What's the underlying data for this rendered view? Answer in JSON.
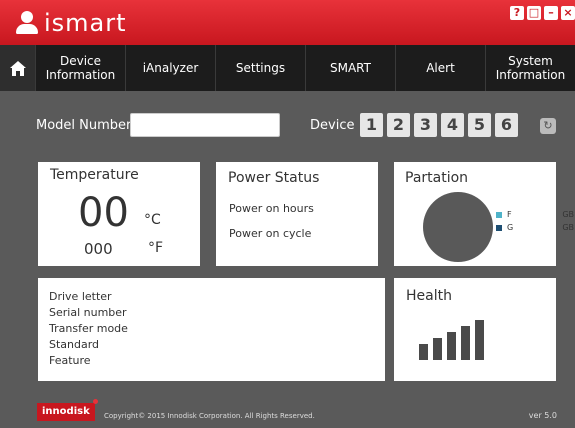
{
  "app": {
    "logo_text": "ismart",
    "brand_color": "#c8171f"
  },
  "window_controls": [
    "?",
    "□",
    "–",
    "×"
  ],
  "nav": {
    "home_icon": "home-icon",
    "items": [
      {
        "label": "Device Information"
      },
      {
        "label": "iAnalyzer"
      },
      {
        "label": "Settings"
      },
      {
        "label": "SMART"
      },
      {
        "label": "Alert"
      },
      {
        "label": "System Information"
      }
    ]
  },
  "model": {
    "label": "Model Number",
    "value": ""
  },
  "device": {
    "label": "Device",
    "buttons": [
      "1",
      "2",
      "3",
      "4",
      "5",
      "6"
    ],
    "refresh_icon": "refresh-icon"
  },
  "temperature": {
    "title": "Temperature",
    "celsius": "00",
    "celsius_unit": "°C",
    "fahrenheit": "000",
    "fahrenheit_unit": "°F"
  },
  "power": {
    "title": "Power Status",
    "hours_label": "Power on hours",
    "cycle_label": "Power on cycle"
  },
  "partition": {
    "title": "Partation",
    "legend": [
      {
        "label": "F",
        "unit": "GB",
        "color": "#4fb3c9"
      },
      {
        "label": "G",
        "unit": "GB",
        "color": "#1f4f73"
      }
    ],
    "pie_color": "#595959"
  },
  "drive_info": {
    "lines": [
      "Drive letter",
      "Serial number",
      "Transfer mode",
      "Standard",
      "Feature"
    ]
  },
  "health": {
    "title": "Health",
    "bar_levels": [
      0.4,
      0.55,
      0.7,
      0.85,
      1.0
    ]
  },
  "footer": {
    "brand": "innodisk",
    "copyright": "Copyright© 2015 Innodisk Corporation. All Rights Reserved.",
    "version": "ver 5.0"
  }
}
